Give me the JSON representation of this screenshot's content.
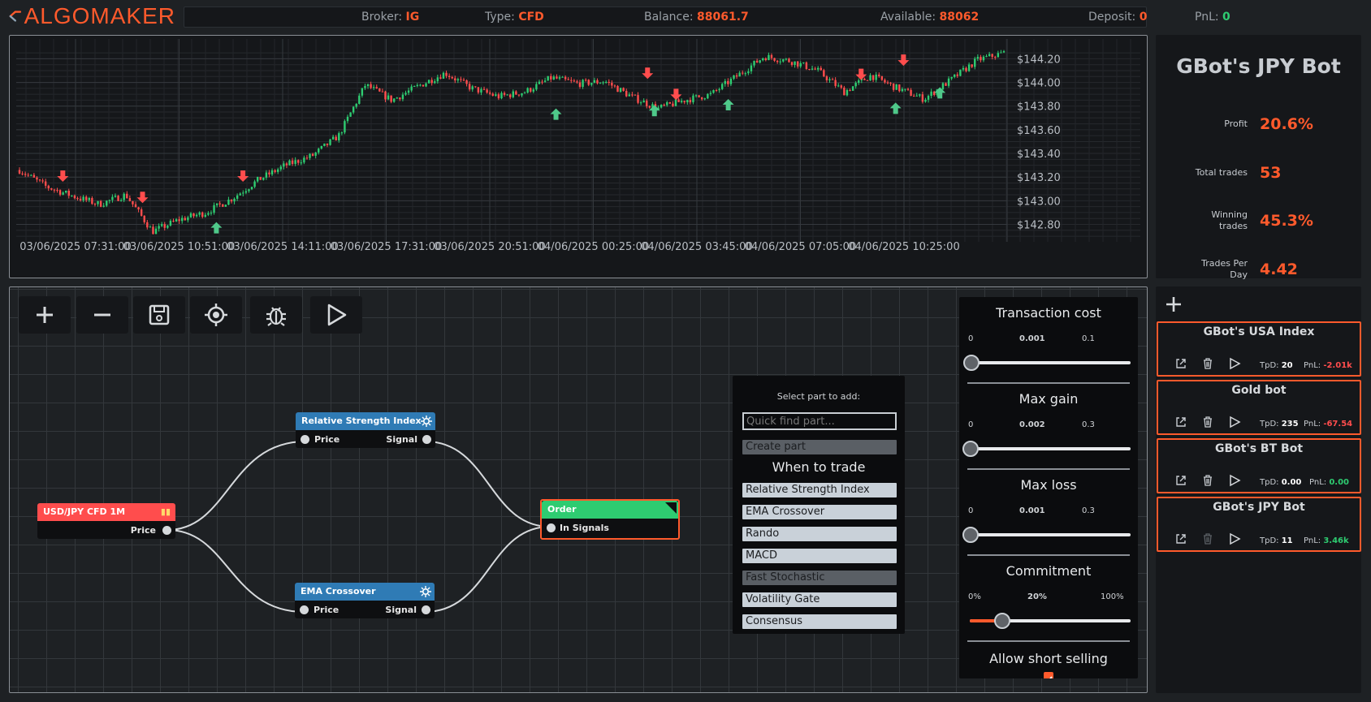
{
  "header": {
    "logo_text": "ALGOMAKER",
    "broker_label": "Broker:",
    "broker": "IG",
    "type_label": "Type:",
    "type": "CFD",
    "balance_label": "Balance:",
    "balance": "88061.7",
    "available_label": "Available:",
    "available": "88062",
    "deposit_label": "Deposit:",
    "deposit": "0",
    "pnl_label": "PnL:",
    "pnl": "0"
  },
  "chart_data": {
    "type": "candlestick",
    "y_tick_labels": [
      "$144.20",
      "$144.00",
      "$143.80",
      "$143.60",
      "$143.40",
      "$143.20",
      "$143.00",
      "$142.80"
    ],
    "x_tick_labels": [
      "03/06/2025 07:31:00",
      "03/06/2025 10:51:00",
      "03/06/2025 14:11:00",
      "03/06/2025 17:31:00",
      "03/06/2025 20:51:00",
      "04/06/2025 00:25:00",
      "04/06/2025 03:45:00",
      "04/06/2025 07:05:00",
      "04/06/2025 10:25:00"
    ],
    "ylim": [
      142.68,
      144.34
    ],
    "price_path": [
      143.26,
      143.12,
      143.04,
      142.97,
      143.05,
      142.74,
      142.84,
      142.9,
      143.02,
      143.18,
      143.3,
      143.38,
      143.55,
      143.98,
      143.85,
      143.97,
      144.08,
      143.95,
      143.88,
      143.92,
      144.04,
      143.99,
      144.01,
      143.88,
      143.78,
      143.85,
      143.9,
      144.06,
      144.22,
      144.18,
      144.1,
      143.92,
      144.06,
      143.95,
      143.86,
      144.02,
      144.19,
      144.25
    ],
    "grid": true,
    "colors": {
      "up": "#2ecc71",
      "down": "#ff4d4d",
      "buy_marker": "#4fc98a",
      "sell_marker": "#ff4d4d"
    },
    "buy_markers": [
      {
        "time_index": 0.2,
        "price": 142.82
      },
      {
        "time_index": 0.545,
        "price": 143.78
      },
      {
        "time_index": 0.645,
        "price": 143.81
      },
      {
        "time_index": 0.72,
        "price": 143.86
      },
      {
        "time_index": 0.89,
        "price": 143.83
      },
      {
        "time_index": 0.935,
        "price": 143.96
      }
    ],
    "sell_markers": [
      {
        "time_index": 0.044,
        "price": 143.16
      },
      {
        "time_index": 0.125,
        "price": 142.98
      },
      {
        "time_index": 0.227,
        "price": 143.16
      },
      {
        "time_index": 0.638,
        "price": 144.03
      },
      {
        "time_index": 0.667,
        "price": 143.85
      },
      {
        "time_index": 0.855,
        "price": 144.02
      },
      {
        "time_index": 0.898,
        "price": 144.14
      }
    ]
  },
  "stats": {
    "title": "GBot's JPY Bot",
    "items": [
      {
        "label": "Profit",
        "value": "20.6%"
      },
      {
        "label": "Total trades",
        "value": "53"
      },
      {
        "label": "Winning trades",
        "value": "45.3%"
      },
      {
        "label": "Trades Per Day",
        "value": "4.42"
      }
    ]
  },
  "toolbar": {
    "icons": [
      "plus-icon",
      "minus-icon",
      "save-icon",
      "target-icon",
      "bug-icon",
      "play-icon"
    ]
  },
  "nodes": {
    "source": {
      "title": "USD/JPY CFD 1M",
      "out_port": "Price",
      "color": "#ff4d4d"
    },
    "rsi": {
      "title": "Relative Strength Index",
      "in_port": "Price",
      "out_port": "Signal",
      "color": "#2f7bb5"
    },
    "ema": {
      "title": "EMA Crossover",
      "in_port": "Price",
      "out_port": "Signal",
      "color": "#2f7bb5"
    },
    "order": {
      "title": "Order",
      "in_port": "In Signals",
      "color": "#2ecc71"
    }
  },
  "picker": {
    "title": "Select part to add:",
    "search_placeholder": "Quick find part...",
    "create_label": "Create part",
    "section": "When to trade",
    "items": [
      "Relative Strength Index",
      "EMA Crossover",
      "Rando",
      "MACD",
      "Fast Stochastic",
      "Volatility Gate",
      "Consensus"
    ]
  },
  "params": {
    "sliders": [
      {
        "title": "Transaction cost",
        "min": "0",
        "current": "0.001",
        "max": "0.1",
        "fraction": 0.01
      },
      {
        "title": "Max gain",
        "min": "0",
        "current": "0.002",
        "max": "0.3",
        "fraction": 0.007
      },
      {
        "title": "Max loss",
        "min": "0",
        "current": "0.001",
        "max": "0.3",
        "fraction": 0.003
      },
      {
        "title": "Commitment",
        "min": "0%",
        "current": "20%",
        "max": "100%",
        "fraction": 0.2
      }
    ],
    "allow_short_label": "Allow short selling",
    "allow_short": true
  },
  "bots": {
    "cards": [
      {
        "name": "GBot's USA Index",
        "tpd_label": "TpD:",
        "tpd": "20",
        "pnl_label": "PnL:",
        "pnl": "-2.01k",
        "sign": "neg"
      },
      {
        "name": "Gold bot",
        "tpd_label": "TpD:",
        "tpd": "235",
        "pnl_label": "PnL:",
        "pnl": "-67.54",
        "sign": "neg"
      },
      {
        "name": "GBot's BT Bot",
        "tpd_label": "TpD:",
        "tpd": "0.00",
        "pnl_label": "PnL:",
        "pnl": "0.00",
        "sign": "pos"
      },
      {
        "name": "GBot's JPY Bot",
        "tpd_label": "TpD:",
        "tpd": "11",
        "pnl_label": "PnL:",
        "pnl": "3.46k",
        "sign": "pos"
      }
    ]
  }
}
